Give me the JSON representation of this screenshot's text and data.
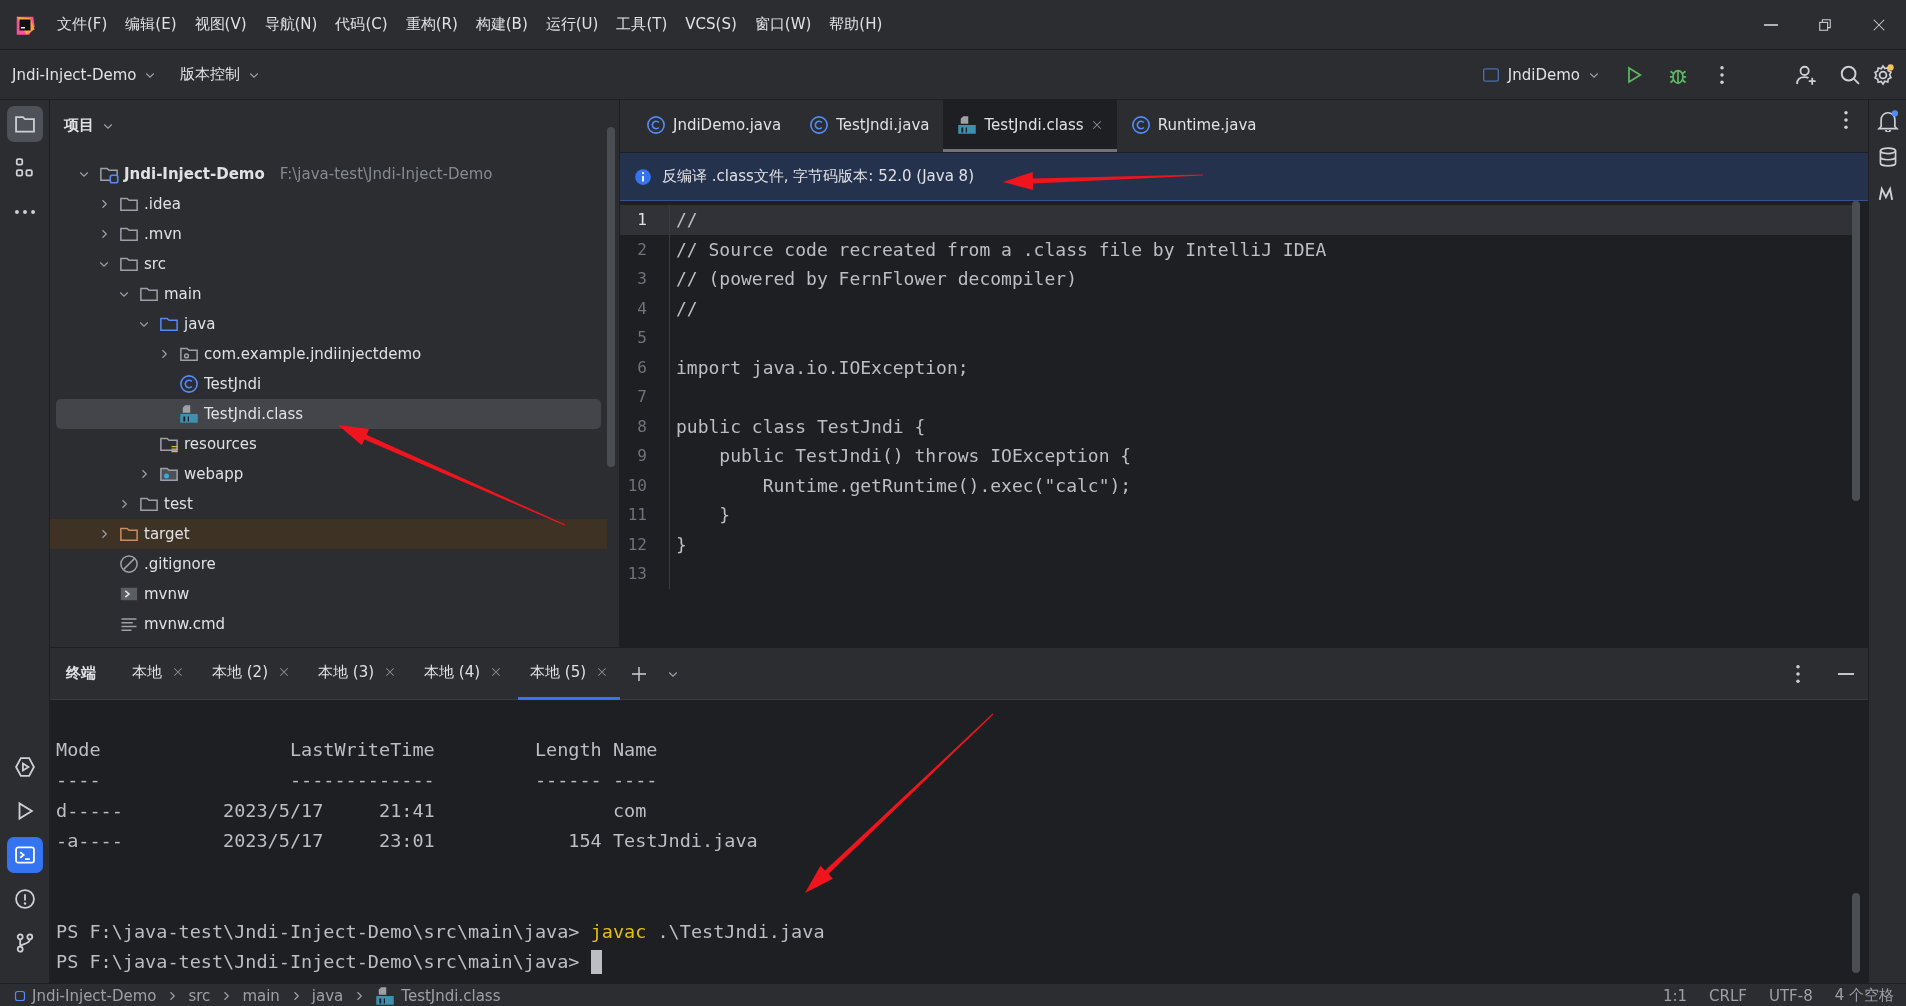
{
  "menu": [
    "文件(F)",
    "编辑(E)",
    "视图(V)",
    "导航(N)",
    "代码(C)",
    "重构(R)",
    "构建(B)",
    "运行(U)",
    "工具(T)",
    "VCS(S)",
    "窗口(W)",
    "帮助(H)"
  ],
  "toolbar": {
    "project": "Jndi-Inject-Demo",
    "vcs": "版本控制",
    "run_config": "JndiDemo"
  },
  "left_tools": [
    {
      "kind": "folder",
      "selected": true
    },
    {
      "kind": "structure",
      "selected": false
    },
    {
      "kind": "more",
      "selected": false
    }
  ],
  "left_tools_bottom": [
    {
      "kind": "services",
      "selected": false
    },
    {
      "kind": "run",
      "selected": false
    },
    {
      "kind": "terminal",
      "selected": true
    },
    {
      "kind": "problems",
      "selected": false
    },
    {
      "kind": "git",
      "selected": false
    }
  ],
  "project_panel": {
    "title": "项目",
    "tree": [
      {
        "name": "Jndi-Inject-Demo",
        "path": "F:\\java-test\\Jndi-Inject-Demo",
        "kind": "module",
        "expanded": true,
        "selected": false,
        "children": [
          {
            "name": ".idea",
            "kind": "folder",
            "expanded": false,
            "selected": false
          },
          {
            "name": ".mvn",
            "kind": "folder",
            "expanded": false,
            "selected": false
          },
          {
            "name": "src",
            "kind": "folder",
            "expanded": true,
            "selected": false,
            "children": [
              {
                "name": "main",
                "kind": "folder",
                "expanded": true,
                "selected": false,
                "children": [
                  {
                    "name": "java",
                    "kind": "source-folder",
                    "expanded": true,
                    "selected": false,
                    "children": [
                      {
                        "name": "com.example.jndiinjectdemo",
                        "kind": "package",
                        "expanded": false,
                        "selected": false
                      },
                      {
                        "name": "TestJndi",
                        "kind": "class",
                        "selected": false
                      },
                      {
                        "name": "TestJndi.class",
                        "kind": "classfile",
                        "selected": true
                      }
                    ]
                  },
                  {
                    "name": "resources",
                    "kind": "resources",
                    "selected": false
                  },
                  {
                    "name": "webapp",
                    "kind": "webapp",
                    "expanded": false,
                    "selected": false
                  }
                ]
              },
              {
                "name": "test",
                "kind": "folder",
                "expanded": false,
                "selected": false
              }
            ]
          },
          {
            "name": "target",
            "kind": "excluded-folder",
            "expanded": false,
            "selected": false
          },
          {
            "name": ".gitignore",
            "kind": "gitignore",
            "selected": false
          },
          {
            "name": "mvnw",
            "kind": "script",
            "selected": false
          },
          {
            "name": "mvnw.cmd",
            "kind": "text",
            "selected": false
          }
        ]
      }
    ]
  },
  "editor_tabs": [
    {
      "label": "JndiDemo.java",
      "kind": "class",
      "selected": false
    },
    {
      "label": "TestJndi.java",
      "kind": "class",
      "selected": false
    },
    {
      "label": "TestJndi.class",
      "kind": "classfile",
      "selected": true
    },
    {
      "label": "Runtime.java",
      "kind": "class",
      "selected": false
    }
  ],
  "banner": "反编译 .class文件, 字节码版本: 52.0 (Java 8)",
  "code": [
    {
      "number": "1",
      "text": "//",
      "current": true
    },
    {
      "number": "2",
      "text": "// Source code recreated from a .class file by IntelliJ IDEA",
      "current": false
    },
    {
      "number": "3",
      "text": "// (powered by FernFlower decompiler)",
      "current": false
    },
    {
      "number": "4",
      "text": "//",
      "current": false
    },
    {
      "number": "5",
      "current": false
    },
    {
      "number": "6",
      "text": "import java.io.IOException;",
      "current": false
    },
    {
      "number": "7",
      "current": false
    },
    {
      "number": "8",
      "text": "public class TestJndi {",
      "current": false
    },
    {
      "number": "9",
      "text": "    public TestJndi() throws IOException {",
      "current": false
    },
    {
      "number": "10",
      "text": "        Runtime.getRuntime().exec(\"calc\");",
      "current": false
    },
    {
      "number": "11",
      "text": "    }",
      "current": false
    },
    {
      "number": "12",
      "text": "}",
      "current": false
    },
    {
      "number": "13",
      "current": false
    }
  ],
  "terminal": {
    "title": "终端",
    "tabs": [
      {
        "label": "本地",
        "selected": false
      },
      {
        "label": "本地 (2)",
        "selected": false
      },
      {
        "label": "本地 (3)",
        "selected": false
      },
      {
        "label": "本地 (4)",
        "selected": false
      },
      {
        "label": "本地 (5)",
        "selected": true
      }
    ],
    "lines": [
      {
        "kind": "output"
      },
      {
        "kind": "output",
        "text": "Mode                 LastWriteTime         Length Name"
      },
      {
        "kind": "output",
        "text": "----                 -------------         ------ ----"
      },
      {
        "kind": "output",
        "text": "d-----         2023/5/17     21:41                com"
      },
      {
        "kind": "output",
        "text": "-a----         2023/5/17     23:01            154 TestJndi.java"
      },
      {
        "kind": "output"
      },
      {
        "kind": "output"
      },
      {
        "kind": "prompt",
        "prompt": "PS F:\\java-test\\Jndi-Inject-Demo\\src\\main\\java> ",
        "command": "javac",
        "args": " .\\TestJndi.java"
      },
      {
        "kind": "prompt-cursor",
        "prompt": "PS F:\\java-test\\Jndi-Inject-Demo\\src\\main\\java> "
      }
    ]
  },
  "status_bar": {
    "breadcrumbs": [
      {
        "label": "Jndi-Inject-Demo",
        "kind": "module"
      },
      {
        "label": "src",
        "kind": "plain"
      },
      {
        "label": "main",
        "kind": "plain"
      },
      {
        "label": "java",
        "kind": "plain"
      },
      {
        "label": "TestJndi.class",
        "kind": "classfile"
      }
    ],
    "items": [
      "1:1",
      "CRLF",
      "UTF-8",
      "4 个空格"
    ]
  }
}
